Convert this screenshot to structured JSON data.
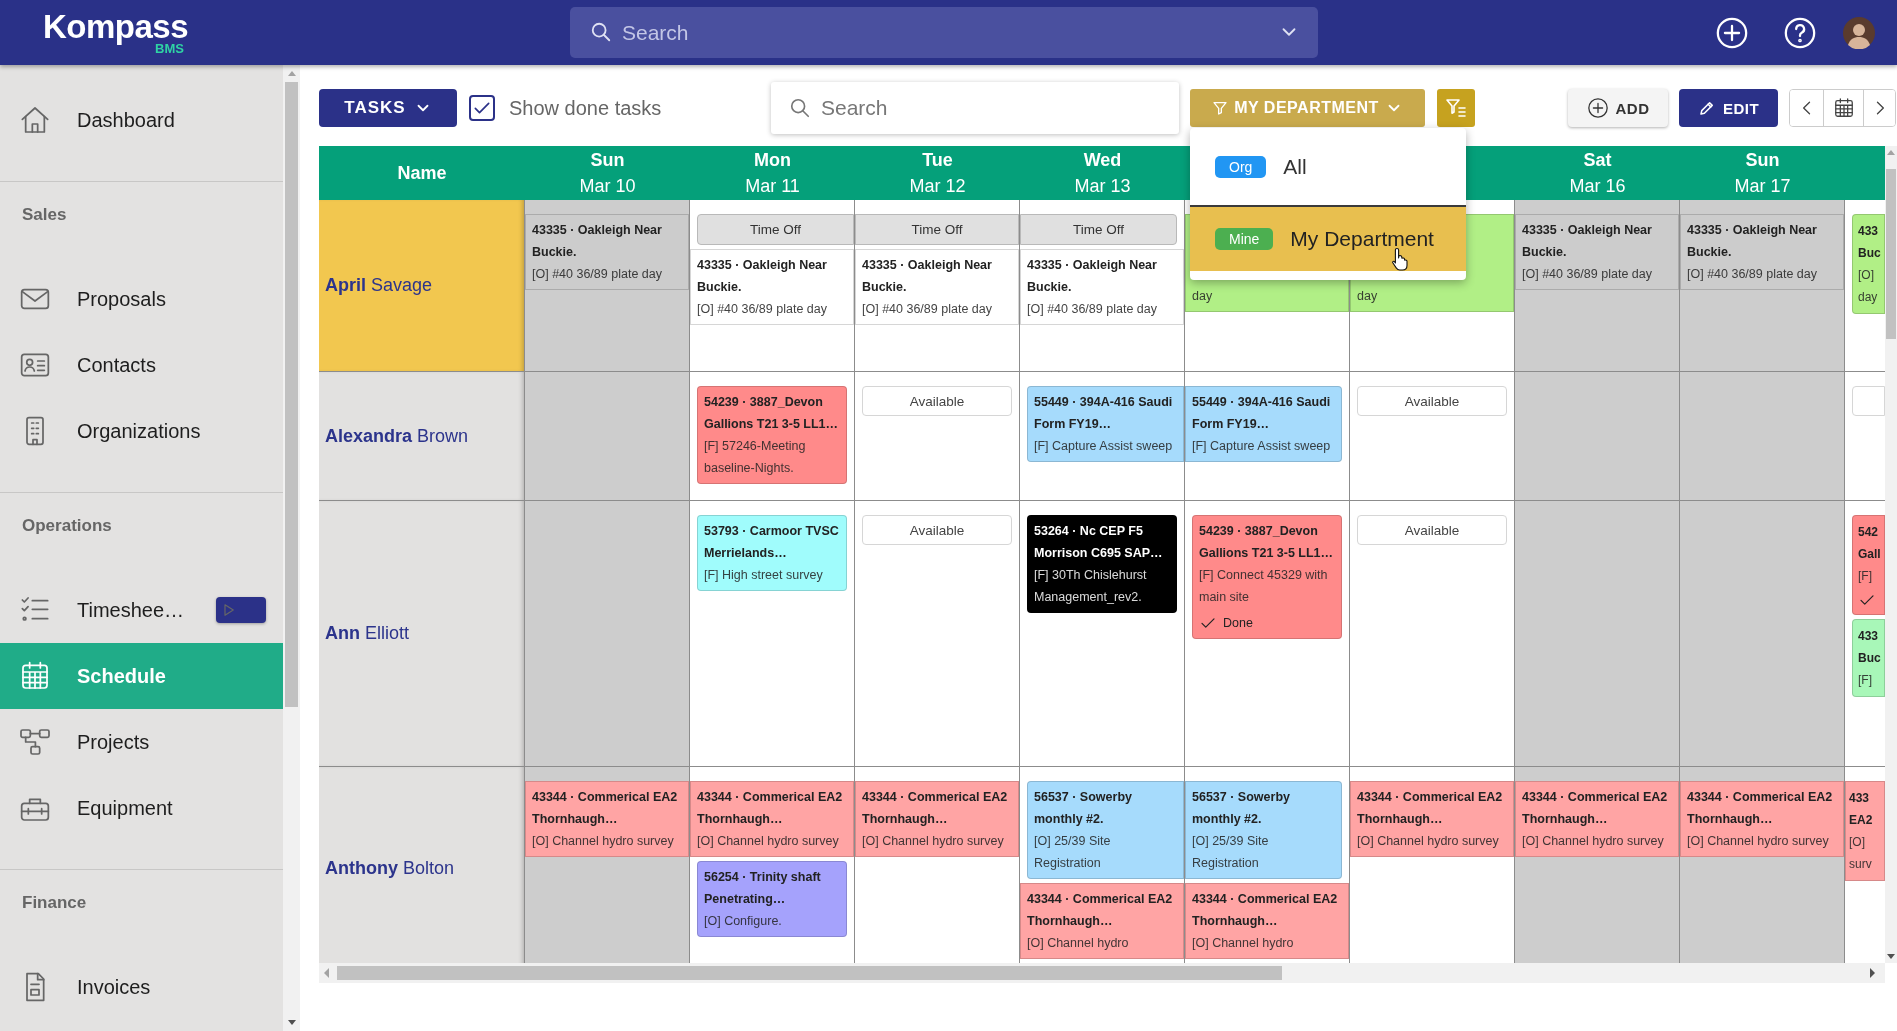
{
  "app": {
    "logo": "Kompass",
    "logo_sub": "BMS",
    "search": {
      "placeholder": "Search"
    }
  },
  "sidebar": {
    "groups": [
      {
        "items": [
          {
            "label": "Dashboard",
            "selected": false,
            "play_button": false
          }
        ]
      },
      {
        "title": "Sales",
        "items": [
          {
            "label": "Proposals",
            "selected": false,
            "play_button": false
          },
          {
            "label": "Contacts",
            "selected": false,
            "play_button": false
          },
          {
            "label": "Organizations",
            "selected": false,
            "play_button": false
          }
        ]
      },
      {
        "title": "Operations",
        "items": [
          {
            "label": "Timeshee…",
            "selected": false,
            "play_button": true
          },
          {
            "label": "Schedule",
            "selected": true,
            "play_button": false
          },
          {
            "label": "Projects",
            "selected": false,
            "play_button": false
          },
          {
            "label": "Equipment",
            "selected": false,
            "play_button": false
          }
        ]
      },
      {
        "title": "Finance",
        "items": [
          {
            "label": "Invoices",
            "selected": false,
            "play_button": false
          }
        ]
      }
    ]
  },
  "toolbar": {
    "tasks_button": "TASKS",
    "show_done": {
      "label": "Show done tasks",
      "checked": true
    },
    "search": {
      "placeholder": "Search"
    },
    "department_button": "MY DEPARTMENT",
    "add_button": "ADD",
    "edit_button": "EDIT"
  },
  "department_menu": {
    "options": [
      {
        "badge": "Org",
        "color": "#2196f3",
        "label": "All",
        "selected": false
      },
      {
        "badge": "Mine",
        "color": "#4caf50",
        "label": "My Department",
        "selected": true
      }
    ]
  },
  "schedule": {
    "name_header": "Name",
    "days": [
      {
        "dow": "Sun",
        "date": "Mar 10",
        "weekend": true
      },
      {
        "dow": "Mon",
        "date": "Mar 11",
        "weekend": false
      },
      {
        "dow": "Tue",
        "date": "Mar 12",
        "weekend": false
      },
      {
        "dow": "Wed",
        "date": "Mar 13",
        "weekend": false
      },
      {
        "weekend": false
      },
      {
        "weekend": false
      },
      {
        "dow": "Sat",
        "date": "Mar 16",
        "weekend": true
      },
      {
        "dow": "Sun",
        "date": "Mar 17",
        "weekend": true
      },
      {
        "weekend": false
      }
    ],
    "rows": [
      {
        "name": "**April** Savage",
        "highlighted": true,
        "cells": [
          [
            {
              "kind": "event",
              "color": "#cccccc",
              "title": "43335 · Oakleigh Near Buckie.",
              "body": "[O] #40 36/89 plate day",
              "open_left": true,
              "open_right": true
            }
          ],
          [
            {
              "kind": "time_off",
              "label": "Time Off",
              "open_right": true
            },
            {
              "kind": "event",
              "color": "#ffffff",
              "title": "43335 · Oakleigh Near Buckie.",
              "body": "[O] #40 36/89 plate day",
              "open_left": true,
              "open_right": true
            }
          ],
          [
            {
              "kind": "time_off",
              "label": "Time Off",
              "open_left": true,
              "open_right": true
            },
            {
              "kind": "event",
              "color": "#ffffff",
              "title": "43335 · Oakleigh Near Buckie.",
              "body": "[O] #40 36/89 plate day",
              "open_left": true,
              "open_right": true
            }
          ],
          [
            {
              "kind": "time_off",
              "label": "Time Off",
              "open_left": true
            },
            {
              "kind": "event",
              "color": "#ffffff",
              "title": "43335 · Oakleigh Near Buckie.",
              "body": "[O] #40 36/89 plate day",
              "open_left": true,
              "open_right": true
            }
          ],
          [
            {
              "kind": "event",
              "color": "#b1ef86",
              "body": "day",
              "open_left": true,
              "open_right": true
            }
          ],
          [
            {
              "kind": "event",
              "color": "#b1ef86",
              "body": "day",
              "open_left": true,
              "open_right": true
            }
          ],
          [
            {
              "kind": "event",
              "color": "#cccccc",
              "title": "43335 · Oakleigh Near Buckie.",
              "body": "[O] #40 36/89 plate day",
              "open_left": true,
              "open_right": true
            }
          ],
          [
            {
              "kind": "event",
              "color": "#cccccc",
              "title": "43335 · Oakleigh Near Buckie.",
              "body": "[O] #40 36/89 plate day",
              "open_left": true,
              "open_right": true
            }
          ],
          [
            {
              "kind": "event",
              "color": "#b1ef86",
              "title": "433 Buc",
              "body": "[O] day",
              "open_right": true
            }
          ]
        ]
      },
      {
        "name": "**Alexandra** Brown",
        "highlighted": false,
        "cells": [
          [],
          [
            {
              "kind": "event",
              "color": "#ff8a8a",
              "title": "54239 · 3887_Devon Gallions T21 3-5 LL1…",
              "body": "[F] 57246-Meeting baseline-Nights."
            }
          ],
          [
            {
              "kind": "available",
              "label": "Available"
            }
          ],
          [
            {
              "kind": "event",
              "color": "#a6dbfc",
              "title": "55449 · 394A-416 Saudi Form FY19…",
              "body": "[F] Capture Assist sweep",
              "open_right": true
            }
          ],
          [
            {
              "kind": "event",
              "color": "#a6dbfc",
              "title": "55449 · 394A-416 Saudi Form FY19…",
              "body": "[F] Capture Assist sweep",
              "open_left": true
            }
          ],
          [
            {
              "kind": "available",
              "label": "Available"
            }
          ],
          [],
          [],
          [
            {
              "kind": "available",
              "open_right": true
            }
          ]
        ]
      },
      {
        "name": "**Ann** Elliott",
        "highlighted": false,
        "cells": [
          [],
          [
            {
              "kind": "event",
              "color": "#a0fcfc",
              "title": "53793 · Carmoor TVSC Merrielands…",
              "body": "[F] High street survey"
            }
          ],
          [
            {
              "kind": "available",
              "label": "Available"
            }
          ],
          [
            {
              "kind": "event",
              "color": "#000000",
              "title": "53264 · Nc CEP F5 Morrison C695 SAP…",
              "body": "[F] 30Th Chislehurst Management_rev2."
            }
          ],
          [
            {
              "kind": "event",
              "color": "#ff8a8a",
              "title": "54239 · 3887_Devon Gallions T21 3-5 LL1…",
              "body": "[F] Connect 45329 with main site",
              "done": true,
              "status_label": "Done"
            }
          ],
          [
            {
              "kind": "available",
              "label": "Available"
            }
          ],
          [],
          [],
          [
            {
              "kind": "event",
              "color": "#ff8a8a",
              "title": "542 Gall",
              "body": "[F]",
              "done": true,
              "open_right": true
            },
            {
              "kind": "event",
              "color": "#a8f7b8",
              "title": "433 Buc",
              "body": "[F]",
              "open_right": true
            }
          ]
        ]
      },
      {
        "name": "**Anthony** Bolton",
        "highlighted": false,
        "cells": [
          [
            {
              "kind": "event",
              "color": "#ffa4a4",
              "title": "43344 · Commerical EA2 Thornhaugh…",
              "body": "[O] Channel hydro survey",
              "open_left": true,
              "open_right": true
            }
          ],
          [
            {
              "kind": "event",
              "color": "#ffa4a4",
              "title": "43344 · Commerical EA2 Thornhaugh…",
              "body": "[O] Channel hydro survey",
              "open_left": true,
              "open_right": true
            },
            {
              "kind": "event",
              "color": "#a5a2fc",
              "title": "56254 · Trinity shaft Penetrating…",
              "body": "[O] Configure."
            }
          ],
          [
            {
              "kind": "event",
              "color": "#ffa4a4",
              "title": "43344 · Commerical EA2 Thornhaugh…",
              "body": "[O] Channel hydro survey",
              "open_left": true,
              "open_right": true
            }
          ],
          [
            {
              "kind": "event",
              "color": "#a6dbfc",
              "title": "56537 · Sowerby monthly #2.",
              "body": "[O] 25/39 Site Registration",
              "open_right": true
            },
            {
              "kind": "event",
              "color": "#ffa4a4",
              "title": "43344 · Commerical EA2 Thornhaugh…",
              "body": "[O] Channel hydro",
              "open_left": true,
              "open_right": true
            }
          ],
          [
            {
              "kind": "event",
              "color": "#a6dbfc",
              "title": "56537 · Sowerby monthly #2.",
              "body": "[O] 25/39 Site Registration",
              "open_left": true
            },
            {
              "kind": "event",
              "color": "#ffa4a4",
              "title": "43344 · Commerical EA2 Thornhaugh…",
              "body": "[O] Channel hydro",
              "open_left": true,
              "open_right": true
            }
          ],
          [
            {
              "kind": "event",
              "color": "#ffa4a4",
              "title": "43344 · Commerical EA2 Thornhaugh…",
              "body": "[O] Channel hydro survey",
              "open_left": true,
              "open_right": true
            }
          ],
          [
            {
              "kind": "event",
              "color": "#ffa4a4",
              "title": "43344 · Commerical EA2 Thornhaugh…",
              "body": "[O] Channel hydro survey",
              "open_left": true,
              "open_right": true
            }
          ],
          [
            {
              "kind": "event",
              "color": "#ffa4a4",
              "title": "43344 · Commerical EA2 Thornhaugh…",
              "body": "[O] Channel hydro survey",
              "open_left": true,
              "open_right": true
            }
          ],
          [
            {
              "kind": "event",
              "color": "#ffa4a4",
              "title": "433 EA2",
              "body": "[O] surv",
              "open_left": true,
              "open_right": true
            }
          ]
        ]
      }
    ]
  }
}
